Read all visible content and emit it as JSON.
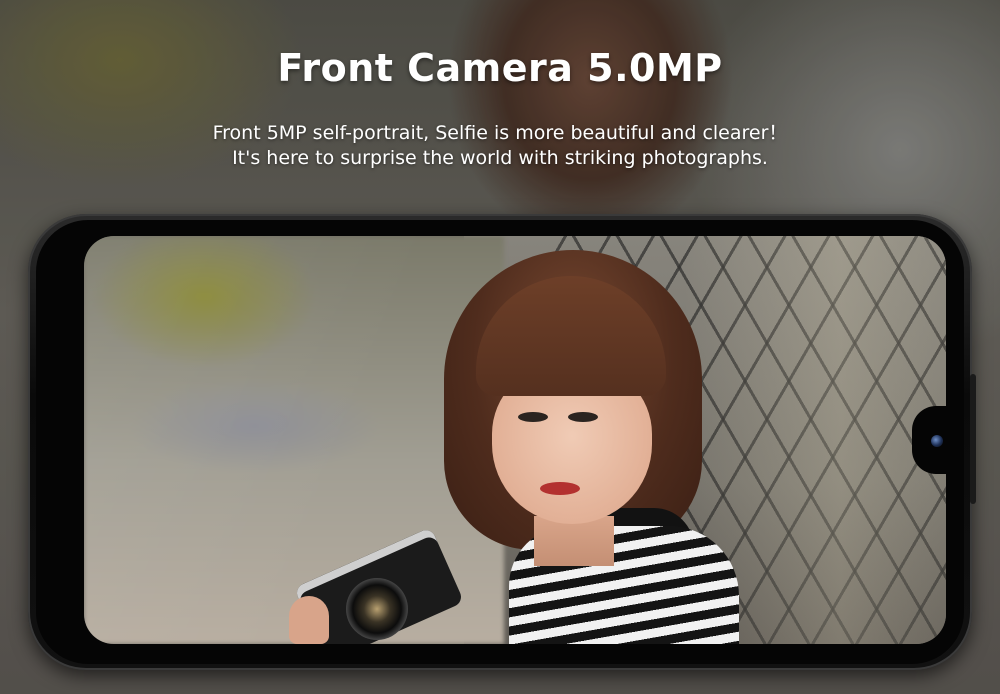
{
  "banner": {
    "title": "Front Camera 5.0MP",
    "subtitle_line1": "Front 5MP self-portrait, Selfie is more beautiful and clearer！",
    "subtitle_line2": "It's here to surprise the world with striking photographs."
  },
  "colors": {
    "title_text": "#ffffff",
    "phone_body": "#0a0a0a",
    "camera_lens": "#1d2f55"
  },
  "icons": {
    "front_camera": "front-camera-icon"
  }
}
